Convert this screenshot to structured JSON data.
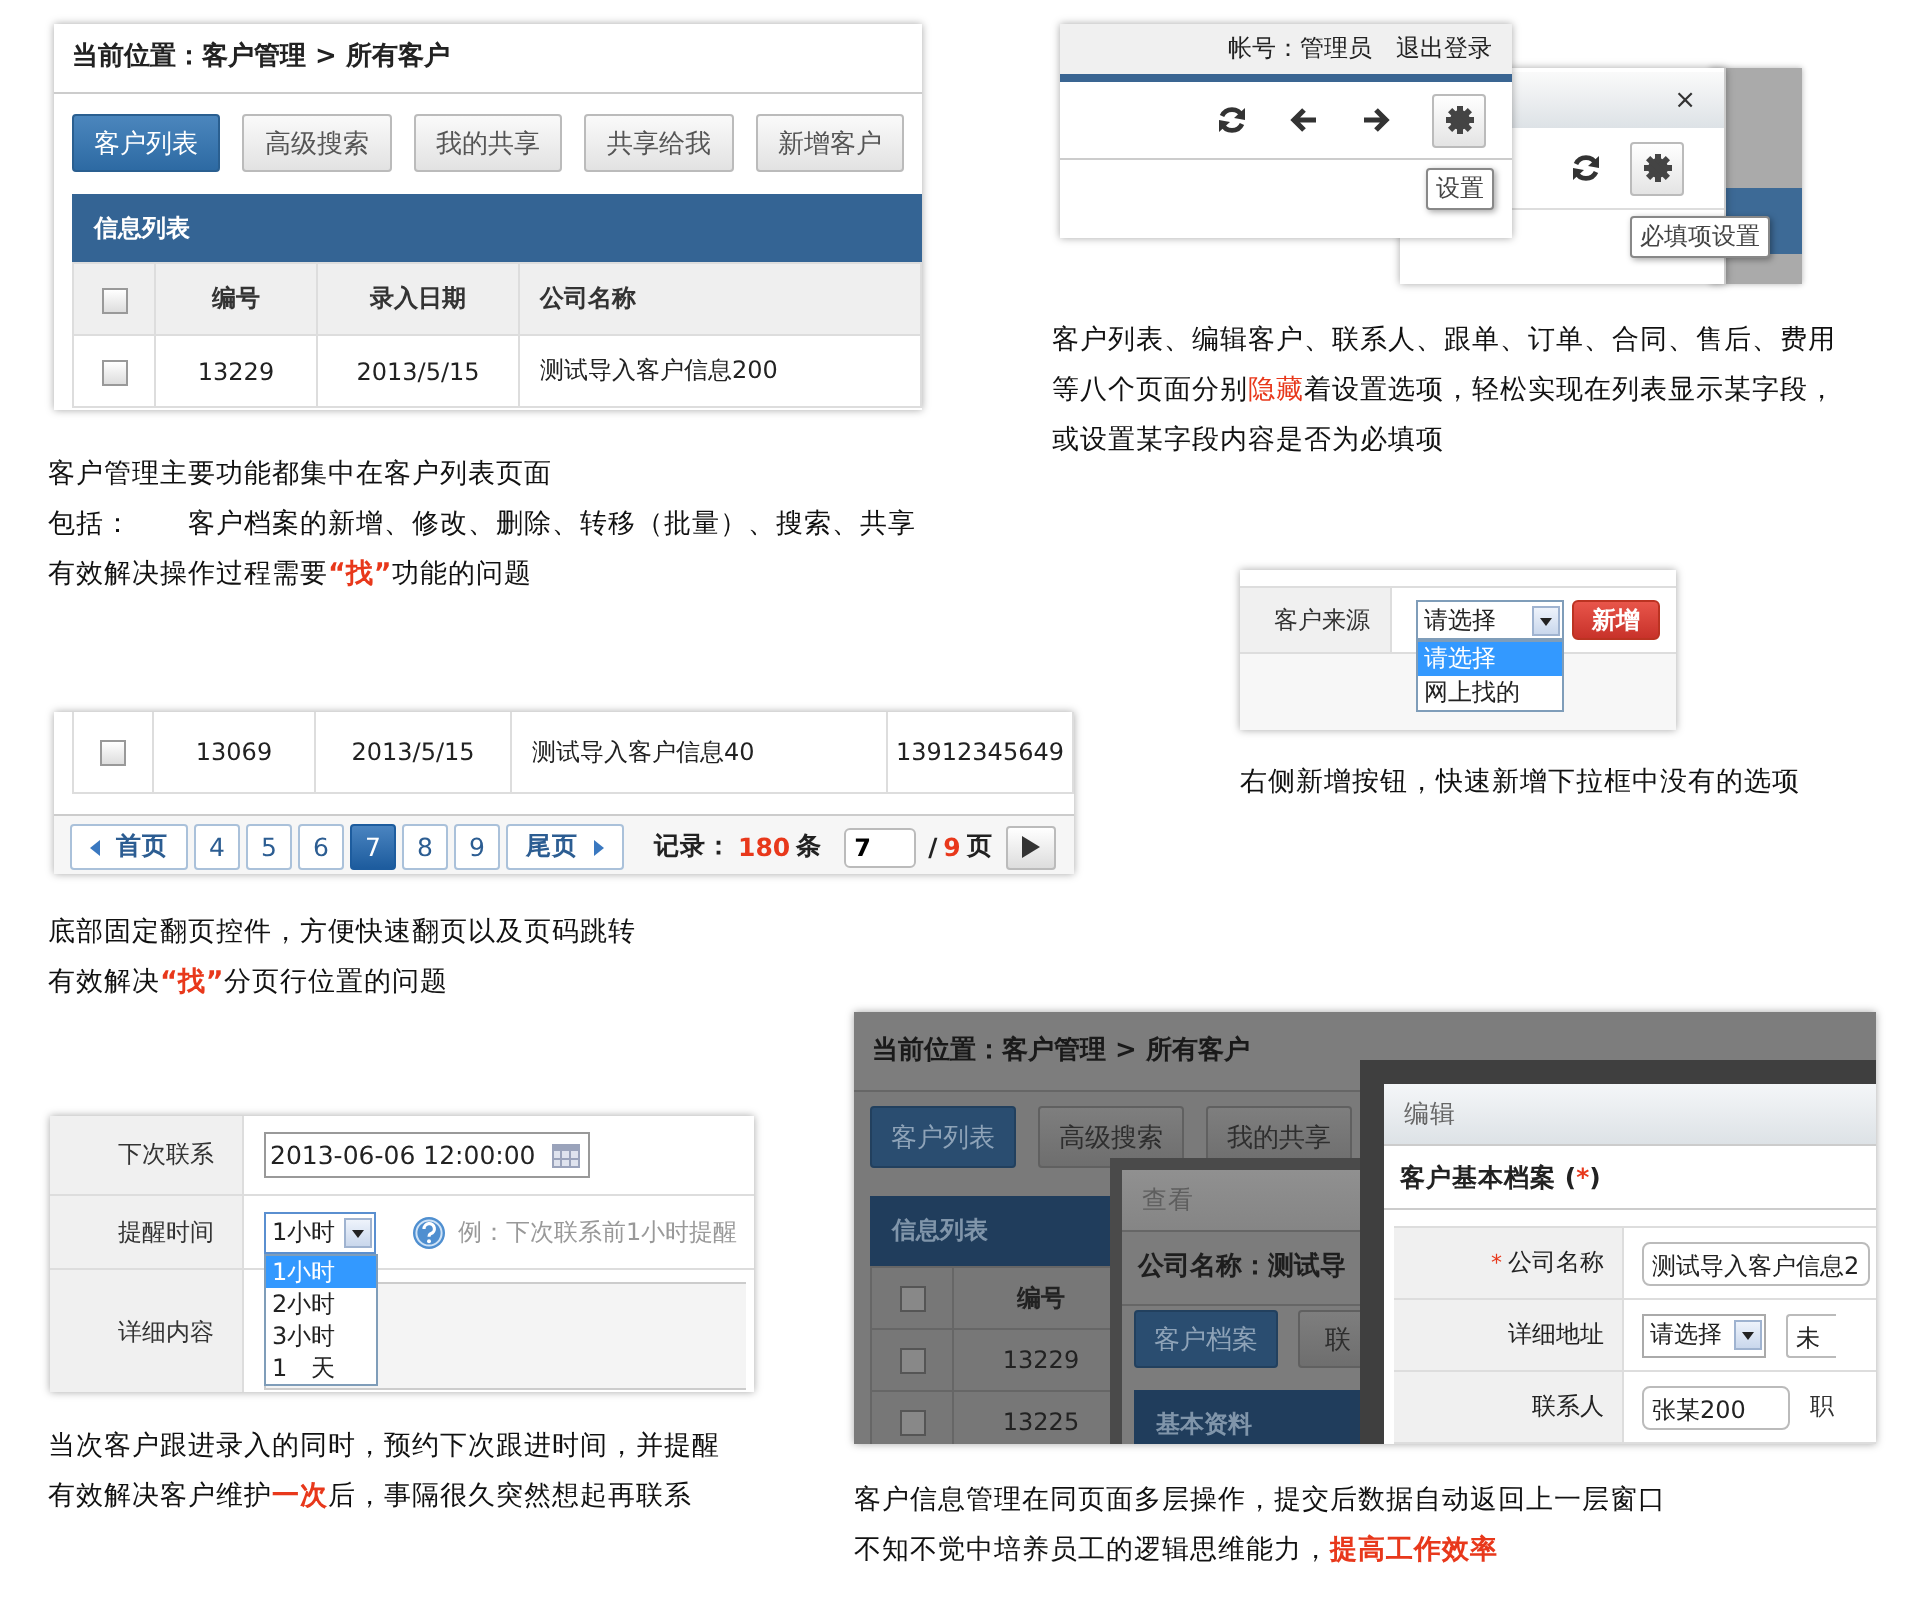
{
  "list_panel": {
    "breadcrumb": "当前位置：客户管理 > 所有客户",
    "buttons": [
      {
        "label": "客户列表",
        "selected": true
      },
      {
        "label": "高级搜索",
        "selected": false
      },
      {
        "label": "我的共享",
        "selected": false
      },
      {
        "label": "共享给我",
        "selected": false
      },
      {
        "label": "新增客户",
        "selected": false
      }
    ],
    "table_title": "信息列表",
    "header_checked": false,
    "columns": [
      "编号",
      "录入日期",
      "公司名称"
    ],
    "rows": [
      {
        "checked": false,
        "cells": [
          "13229",
          "2013/5/15",
          "测试导入客户信息200"
        ]
      }
    ],
    "caption": [
      {
        "parts": [
          {
            "kind": "plain",
            "text": "客户管理主要功能都集中在客户列表页面"
          }
        ]
      },
      {
        "label": "包括：",
        "parts": [
          {
            "kind": "plain",
            "text": "客户档案的新增、修改、删除、转移（批量）、搜索、共享"
          }
        ]
      },
      {
        "parts": [
          {
            "kind": "plain",
            "text": "有效解决操作过程需要 "
          },
          {
            "kind": "red-bold",
            "text": "“找”"
          },
          {
            "kind": "plain",
            "text": " 功能的问题"
          }
        ]
      }
    ]
  },
  "settings_panel": {
    "front": {
      "account": "帐号：管理员",
      "logout": "退出登录",
      "tooltip": "设置"
    },
    "back": {
      "close": "×",
      "tooltip": "必填项设置"
    },
    "caption": [
      {
        "parts": [
          {
            "kind": "plain",
            "text": "客户列表、编辑客户、联系人、跟单、订单、合同、售后、费用"
          }
        ]
      },
      {
        "parts": [
          {
            "kind": "plain",
            "text": "等八个页面分别 "
          },
          {
            "kind": "red",
            "text": "隐藏"
          },
          {
            "kind": "plain",
            "text": " 着设置选项，轻松实现在列表显示某字段，"
          }
        ]
      },
      {
        "parts": [
          {
            "kind": "plain",
            "text": "或设置某字段内容是否为必填项"
          }
        ]
      }
    ]
  },
  "source_panel": {
    "label": "客户来源",
    "value": "请选择",
    "add_button": "新增",
    "options": [
      {
        "label": "请选择",
        "selected": true
      },
      {
        "label": "网上找的",
        "selected": false
      }
    ],
    "caption": [
      {
        "parts": [
          {
            "kind": "plain",
            "text": "右侧新增按钮，快速新增下拉框中没有的选项"
          }
        ]
      }
    ]
  },
  "pager_panel": {
    "row": {
      "checked": false,
      "cells": [
        "13069",
        "2013/5/15",
        "测试导入客户信息40",
        "13912345649"
      ]
    },
    "first": "首页",
    "pages": [
      {
        "label": "4",
        "selected": false
      },
      {
        "label": "5",
        "selected": false
      },
      {
        "label": "6",
        "selected": false
      },
      {
        "label": "7",
        "selected": true
      },
      {
        "label": "8",
        "selected": false
      },
      {
        "label": "9",
        "selected": false
      }
    ],
    "last": "尾页",
    "records_label": "记录：",
    "records": "180",
    "records_unit": "条",
    "page_input": "7",
    "separator": "/",
    "total_pages": "9",
    "pages_unit": "页",
    "caption": [
      {
        "parts": [
          {
            "kind": "plain",
            "text": "底部固定翻页控件，方便快速翻页以及页码跳转"
          }
        ]
      },
      {
        "parts": [
          {
            "kind": "plain",
            "text": "有效解决 "
          },
          {
            "kind": "red-bold",
            "text": "“找”"
          },
          {
            "kind": "plain",
            "text": " 分页行位置的问题"
          }
        ]
      }
    ]
  },
  "reminder_panel": {
    "rows": [
      {
        "kind": "date",
        "label": "下次联系",
        "value": "2013-06-06 12:00:00"
      },
      {
        "kind": "select",
        "label": "提醒时间",
        "value": "1小时",
        "hint": "例：下次联系前1小时提醒",
        "options": [
          {
            "label": "1小时",
            "selected": true
          },
          {
            "label": "2小时",
            "selected": false
          },
          {
            "label": "3小时",
            "selected": false
          },
          {
            "label": "1　天",
            "selected": false
          }
        ]
      },
      {
        "kind": "textarea",
        "label": "详细内容"
      }
    ],
    "caption": [
      {
        "parts": [
          {
            "kind": "plain",
            "text": "当次客户跟进录入的同时，预约下次跟进时间，并提醒"
          }
        ]
      },
      {
        "parts": [
          {
            "kind": "plain",
            "text": "有效解决客户维护 "
          },
          {
            "kind": "red-bold",
            "text": "一次"
          },
          {
            "kind": "plain",
            "text": " 后，事隔很久突然想起再联系"
          }
        ]
      }
    ]
  },
  "layer_panel": {
    "background": {
      "breadcrumb": "当前位置：客户管理 > 所有客户",
      "buttons": [
        {
          "label": "客户列表",
          "selected": true
        },
        {
          "label": "高级搜索",
          "selected": false
        },
        {
          "label": "我的共享",
          "selected": false
        }
      ],
      "table_title": "信息列表",
      "header_checked": false,
      "columns": [
        "编号"
      ],
      "rows": [
        {
          "checked": false,
          "cells": [
            "13229"
          ]
        },
        {
          "checked": false,
          "cells": [
            "13225"
          ]
        }
      ]
    },
    "view_window": {
      "title": "查看",
      "heading": "公司名称：测试导",
      "tabs": [
        {
          "label": "客户档案",
          "selected": true
        },
        {
          "label": "联",
          "selected": false
        }
      ],
      "section": "基本资料"
    },
    "edit_window": {
      "title": "编辑",
      "heading": [
        {
          "kind": "plain",
          "text": "客户基本档案 ("
        },
        {
          "kind": "red",
          "text": "*"
        },
        {
          "kind": "plain",
          "text": ")"
        }
      ],
      "fields": [
        {
          "kind": "text",
          "required_mark": "*",
          "label": "公司名称",
          "value": "测试导入客户信息2"
        },
        {
          "kind": "select",
          "label": "详细地址",
          "value": "请选择",
          "extra": "未"
        },
        {
          "kind": "text",
          "label": "联系人",
          "value": "张某200",
          "extra": "职"
        }
      ]
    },
    "caption": [
      {
        "parts": [
          {
            "kind": "plain",
            "text": "客户信息管理在同页面多层操作，提交后数据自动返回上一层窗口"
          }
        ]
      },
      {
        "parts": [
          {
            "kind": "plain",
            "text": "不知不觉中培养员工的逻辑思维能力，"
          },
          {
            "kind": "red-bold",
            "text": "提高工作效率"
          }
        ]
      }
    ]
  }
}
